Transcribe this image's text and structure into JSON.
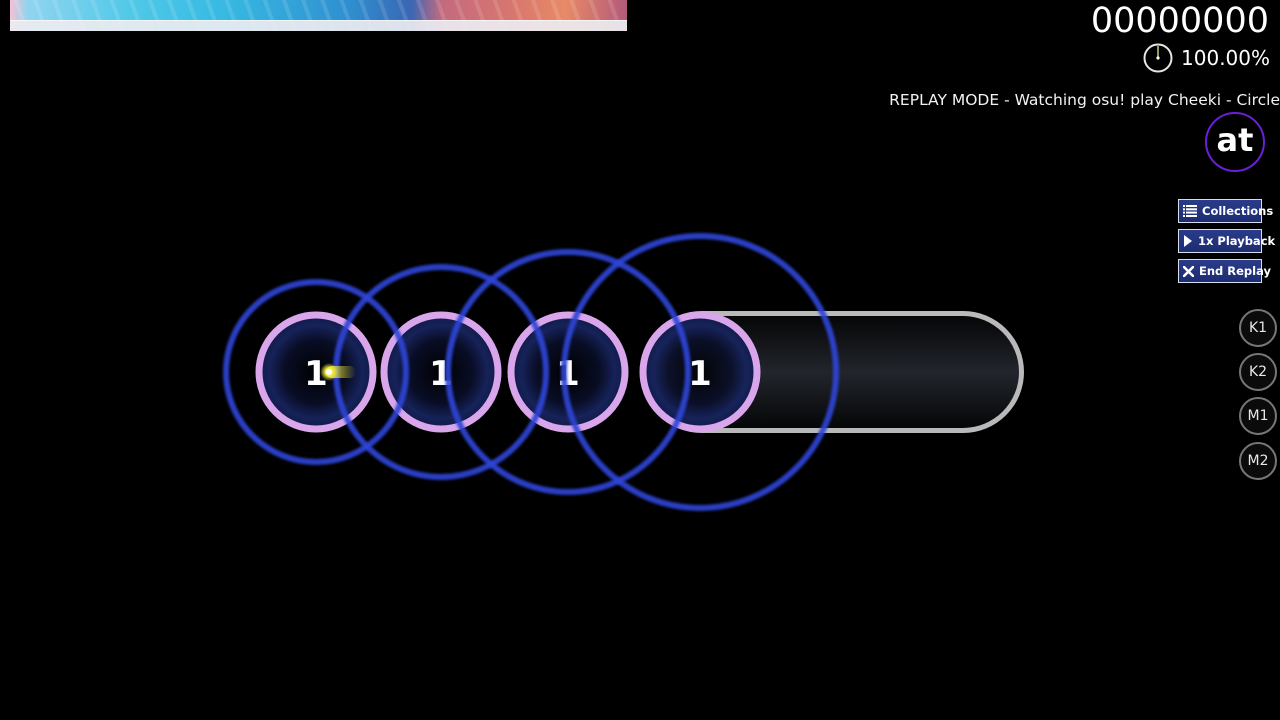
{
  "hud": {
    "score": "00000000",
    "accuracy": "100.00%",
    "song_progress_fraction": 0.0,
    "replay_banner": "REPLAY MODE - Watching osu! play Cheeki - Circle",
    "mod_label": "at",
    "mod_name": "Autoplay"
  },
  "replay_buttons": [
    {
      "label": "Collections",
      "icon": "list-icon"
    },
    {
      "label": "1x Playback",
      "icon": "play-icon"
    },
    {
      "label": "End Replay",
      "icon": "close-icon"
    }
  ],
  "key_overlay": [
    "K1",
    "K2",
    "M1",
    "M2"
  ],
  "hit_objects": [
    {
      "type": "circle",
      "combo_number": "1"
    },
    {
      "type": "circle",
      "combo_number": "1"
    },
    {
      "type": "circle",
      "combo_number": "1"
    },
    {
      "type": "slider",
      "combo_number": "1"
    }
  ],
  "colors": {
    "approach_circle": "#2f45d6",
    "hit_circle_border": "#d9a6ec",
    "hit_circle_fill": "#101a44",
    "slider_border": "#b9b9b9",
    "slider_body": "#1c1f26",
    "mod_ring": "#6b1fd6",
    "button_bg": "#23347d",
    "cursor": "#f5ee3a"
  }
}
